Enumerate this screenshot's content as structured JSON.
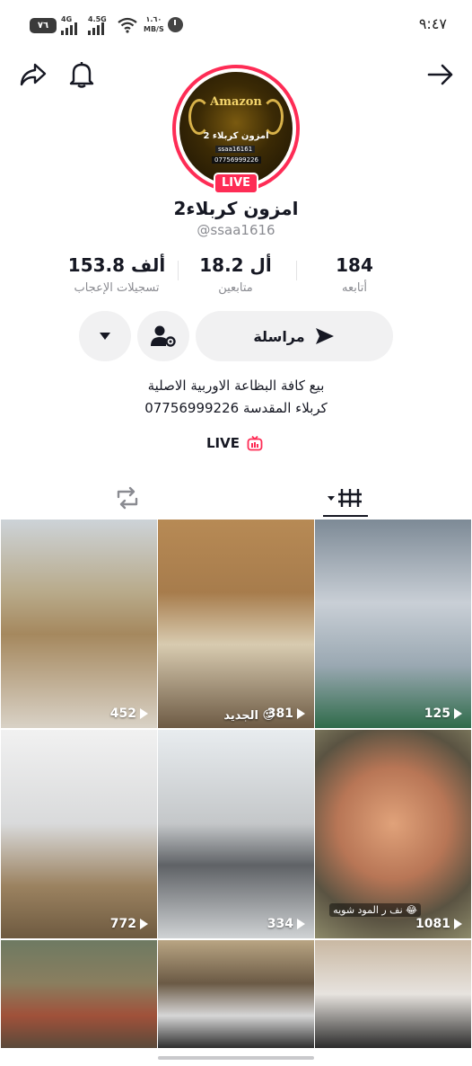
{
  "status_bar": {
    "battery": "٧٦",
    "signal1_label": "4G",
    "signal2_label": "4.5G",
    "speed_value": "١.٦٠",
    "speed_unit": "MB/S",
    "time": "٩:٤٧"
  },
  "profile": {
    "avatar_brand": "Amazon",
    "avatar_shop": "امزون كربلاء 2",
    "avatar_handle": "ssaa16161",
    "avatar_phone": "07756999226",
    "live_badge": "LIVE",
    "display_name": "امزون كربلاء2",
    "username": "@ssaa1616"
  },
  "stats": {
    "following": {
      "value": "184",
      "label": "أتابعه"
    },
    "followers": {
      "value": "18.2 أل",
      "label": "متابعين"
    },
    "likes": {
      "value": "153.8 ألف",
      "label": "تسجيلات الإعجاب"
    }
  },
  "actions": {
    "message_label": "مراسلة"
  },
  "bio": {
    "line1": "بيع كافة البظاعة الاوربية الاصلية",
    "line2": "07756999226 كربلاء المقدسة"
  },
  "live_link": {
    "label": "LIVE"
  },
  "tabs": [
    "videos-tab",
    "reposts-tab"
  ],
  "colors": {
    "accent": "#fe2c55",
    "text": "#161823",
    "secondary": "#8a8b91",
    "button_bg": "#f1f1f2"
  },
  "videos": [
    {
      "views": "125",
      "caption": ""
    },
    {
      "views": "381",
      "caption": "الجديد 😍"
    },
    {
      "views": "452",
      "caption": ""
    },
    {
      "views": "1081",
      "caption": "نف ر المود شويه 😂"
    },
    {
      "views": "334",
      "caption": ""
    },
    {
      "views": "772",
      "caption": ""
    },
    {
      "views": "",
      "caption": ""
    },
    {
      "views": "",
      "caption": ""
    },
    {
      "views": "",
      "caption": ""
    }
  ]
}
